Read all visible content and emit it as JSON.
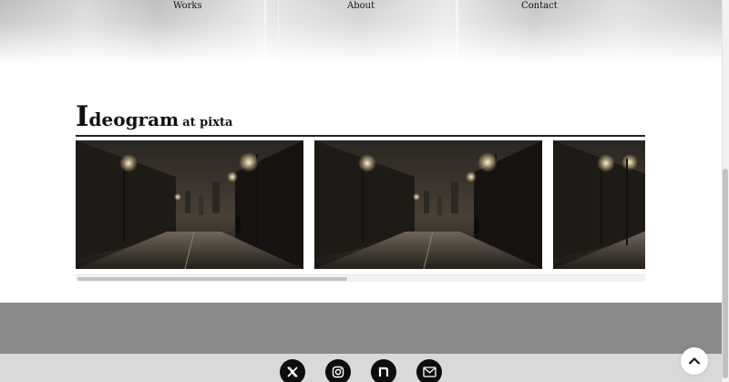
{
  "nav": {
    "items": [
      {
        "label": "Works"
      },
      {
        "label": "About"
      },
      {
        "label": "Contact"
      }
    ]
  },
  "section": {
    "title_initial": "I",
    "title_rest": "deogram",
    "title_suffix": "at pixta"
  },
  "gallery": {
    "images": [
      {
        "icon": "night-street-image"
      },
      {
        "icon": "night-street-image"
      },
      {
        "icon": "night-street-image"
      }
    ]
  },
  "footer": {
    "social": [
      {
        "icon": "x-icon"
      },
      {
        "icon": "instagram-icon"
      },
      {
        "icon": "note-icon"
      },
      {
        "icon": "mail-icon"
      }
    ]
  },
  "colors": {
    "footer_grey": "#8a8a8a",
    "footer_bar": "#d9d9d9",
    "social_bg": "#0d0d0d"
  }
}
